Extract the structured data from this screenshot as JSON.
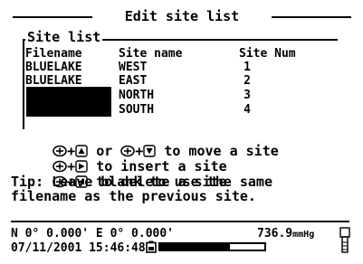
{
  "title": "Edit site list",
  "group_label": "Site list",
  "columns": [
    "Filename",
    "Site name",
    "Site Num"
  ],
  "rows": [
    {
      "filename": "BLUELAKE",
      "site_name": "WEST",
      "site_num": "1"
    },
    {
      "filename": "BLUELAKE",
      "site_name": "EAST",
      "site_num": "2"
    },
    {
      "filename": "",
      "site_name": "NORTH",
      "site_num": "3"
    },
    {
      "filename": "",
      "site_name": "SOUTH",
      "site_num": "4"
    }
  ],
  "help": {
    "move": {
      "or": "or",
      "text": "to move a site"
    },
    "insert": {
      "text": "to insert a site"
    },
    "delete": {
      "text": "to delete a site"
    }
  },
  "tip": {
    "line1": "Tip: Leave blank to use the same",
    "line2": "filename as the previous site."
  },
  "status": {
    "coordinates": "N 0° 0.000' E 0° 0.000'",
    "datetime": "07/11/2001 15:46:48",
    "pressure": "736.9",
    "pressure_unit": "mmHg",
    "battery_level": 0.67
  },
  "icons": {
    "enter_key": "enter-key-icon",
    "up": "up-arrow-icon",
    "down": "down-arrow-icon",
    "right": "right-arrow-icon",
    "left": "left-arrow-icon",
    "battery": "battery-icon",
    "instrument": "instrument-icon"
  }
}
